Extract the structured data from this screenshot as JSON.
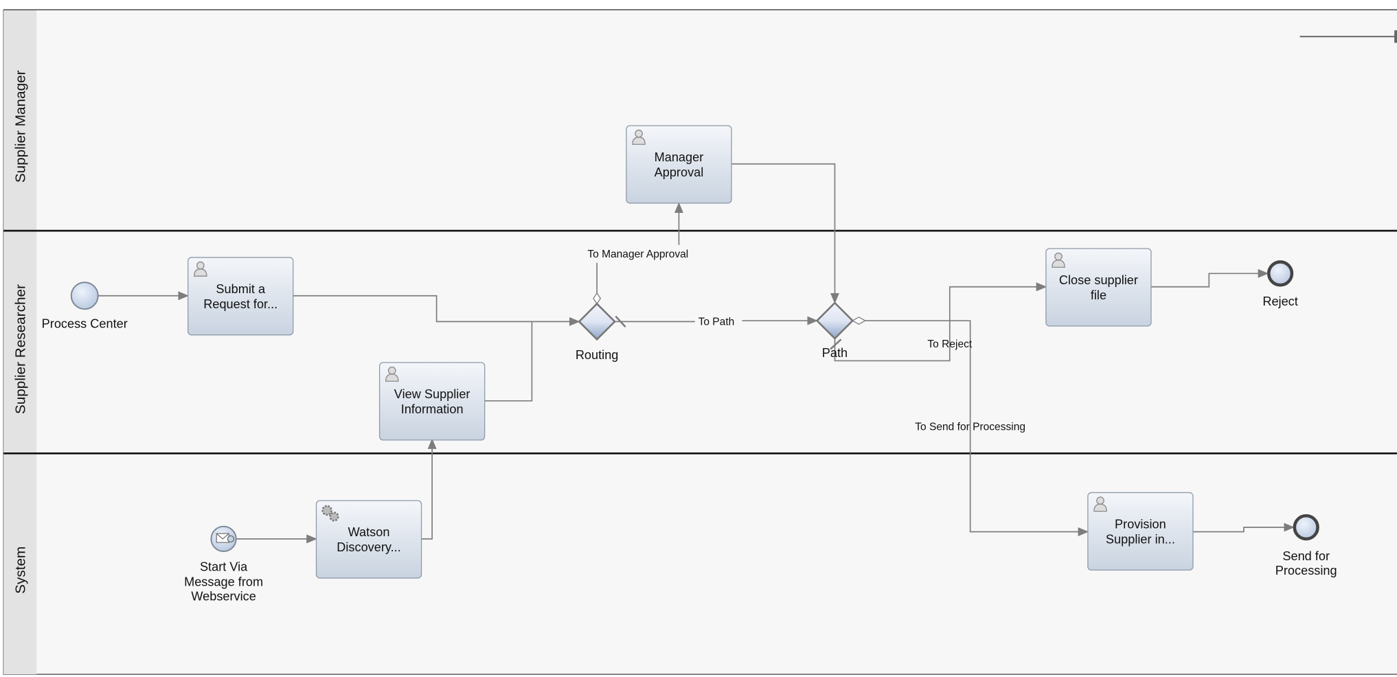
{
  "lanes": [
    {
      "label": "Supplier Manager"
    },
    {
      "label": "Supplier Researcher"
    },
    {
      "label": "System"
    }
  ],
  "tasks": {
    "manager_approval": {
      "lines": [
        "Manager",
        "Approval"
      ],
      "icon": "user-icon"
    },
    "submit_request": {
      "lines": [
        "Submit a",
        "Request for..."
      ],
      "icon": "user-icon"
    },
    "view_supplier": {
      "lines": [
        "View Supplier",
        "Information"
      ],
      "icon": "user-icon"
    },
    "watson_discovery": {
      "lines": [
        "Watson",
        "Discovery..."
      ],
      "icon": "gears-icon"
    },
    "close_supplier": {
      "lines": [
        "Close supplier",
        "file"
      ],
      "icon": "user-icon"
    },
    "provision_supplier": {
      "lines": [
        "Provision",
        "Supplier in..."
      ],
      "icon": "user-icon"
    }
  },
  "events": {
    "process_center": {
      "lines": [
        "Process Center"
      ]
    },
    "message_start": {
      "lines": [
        "Start Via",
        "Message from",
        "Webservice"
      ]
    },
    "reject": {
      "lines": [
        "Reject"
      ]
    },
    "send_for_processing": {
      "lines": [
        "Send for",
        "Processing"
      ]
    }
  },
  "gateways": {
    "routing": {
      "label": "Routing"
    },
    "path": {
      "label": "Path"
    }
  },
  "flows": {
    "to_manager_approval": "To Manager Approval",
    "to_path": "To Path",
    "to_reject": "To Reject",
    "to_send_for_processing": "To Send for Processing"
  },
  "colors": {
    "background": "#f7f7f7",
    "lane_header": "#e3e3e3",
    "flow": "#7d7d7d"
  }
}
